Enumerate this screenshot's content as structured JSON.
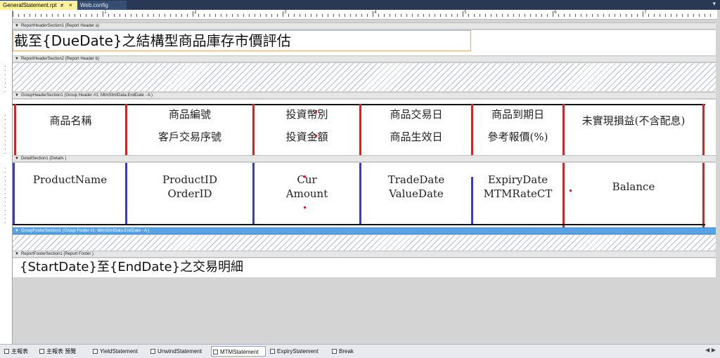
{
  "tabs": {
    "active": "GeneralStatement.rpt",
    "pin": "≠",
    "close": "×",
    "inactive": "Web.config",
    "dropdown": "▾"
  },
  "ruler": {
    "numbers": [
      "1",
      "2",
      "3",
      "4",
      "5",
      "6",
      "7"
    ]
  },
  "bands": {
    "rh_a": "ReportHeaderSection1 (Report Header a)",
    "rh_b": "ReportHeaderSection2 (Report Header b)",
    "gh": "GroupHeaderSection1 (Group Header #1: MtmStmtData.EndDate - A )",
    "detail": "DetailSection1 (Details )",
    "gf": "GroupFooterSection1 (Group Footer #1: MtmStmtData.EndDate - A )",
    "rf": "ReportFooterSection1 (Report Footer )"
  },
  "report_title": "截至{DueDate}之結構型商品庫存市價評估",
  "group_header": {
    "col1": [
      "商品名稱"
    ],
    "col2": [
      "商品編號",
      "客戶交易序號"
    ],
    "col3": [
      "投資幣別",
      "投資金額"
    ],
    "col4": [
      "商品交易日",
      "商品生效日"
    ],
    "col5": [
      "商品到期日",
      "參考報價(%)"
    ],
    "col6": [
      "未實現損益(不含配息)"
    ]
  },
  "detail": {
    "col1": [
      "ProductName"
    ],
    "col2": [
      "ProductID",
      "OrderID"
    ],
    "col3": [
      "Cur",
      "Amount"
    ],
    "col4": [
      "TradeDate",
      "ValueDate"
    ],
    "col5": [
      "ExpiryDate",
      "MTMRateCT"
    ],
    "col6": [
      "Balance"
    ]
  },
  "footer_text": "{StartDate}至{EndDate}之交易明細",
  "bottom_tabs": [
    "主報表",
    "主報表 預覽",
    "YieldStatement",
    "UnwindStatement",
    "MTMStatement",
    "ExpiryStatement",
    "Break"
  ],
  "bottom_nav": "◀ ▶",
  "colors": {
    "red_line": "#e02020",
    "blue_line": "#3b3bc8",
    "selected_band": "#5aa2e6"
  }
}
